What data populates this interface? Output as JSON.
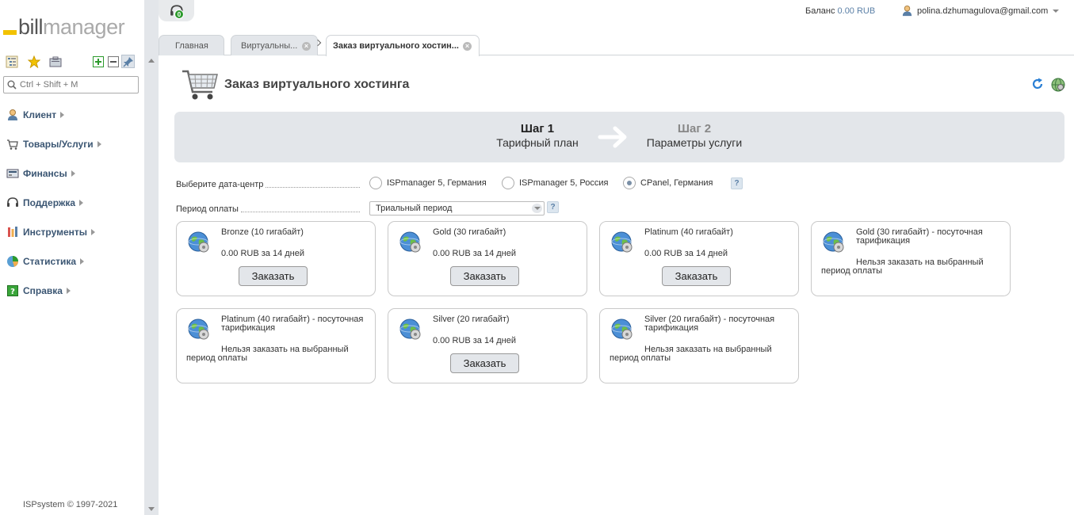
{
  "app": {
    "logo_bill": "bill",
    "logo_manager": "manager",
    "support_badge": "0",
    "copyright": "ISPsystem © 1997-2021"
  },
  "search": {
    "placeholder": "Ctrl + Shift + M"
  },
  "menu": [
    {
      "label": "Клиент",
      "icon": "client-icon"
    },
    {
      "label": "Товары/Услуги",
      "icon": "cart-icon"
    },
    {
      "label": "Финансы",
      "icon": "finance-icon"
    },
    {
      "label": "Поддержка",
      "icon": "headset-icon"
    },
    {
      "label": "Инструменты",
      "icon": "tools-icon"
    },
    {
      "label": "Статистика",
      "icon": "chart-icon"
    },
    {
      "label": "Справка",
      "icon": "help-book-icon"
    }
  ],
  "header": {
    "balance_label": "Баланс",
    "balance_value": "0.00 RUB",
    "user_email": "polina.dzhumagulova@gmail.com"
  },
  "tabs": [
    {
      "label": "Главная"
    },
    {
      "label": "Виртуальны..."
    },
    {
      "label": "Заказ виртуального хостин..."
    }
  ],
  "page": {
    "title": "Заказ виртуального хостинга"
  },
  "wizard": {
    "step1_num": "Шаг 1",
    "step1_title": "Тарифный план",
    "step2_num": "Шаг 2",
    "step2_title": "Параметры услуги"
  },
  "form": {
    "datacenter_label": "Выберите дата-центр",
    "datacenter_options": [
      {
        "label": "ISPmanager 5, Германия",
        "checked": false
      },
      {
        "label": "ISPmanager 5, Россия",
        "checked": false
      },
      {
        "label": "CPanel, Германия",
        "checked": true
      }
    ],
    "period_label": "Период оплаты",
    "period_value": "Триальный период",
    "help_glyph": "?"
  },
  "order_button_label": "Заказать",
  "plans": [
    {
      "name": "Bronze (10 гигабайт)",
      "price": "0.00 RUB за 14 дней",
      "orderable": true
    },
    {
      "name": "Gold (30 гигабайт)",
      "price": "0.00 RUB за 14 дней",
      "orderable": true
    },
    {
      "name": "Platinum (40 гигабайт)",
      "price": "0.00 RUB за 14 дней",
      "orderable": true
    },
    {
      "name": "Gold (30 гигабайт) - посуточная тарификация",
      "message": "Нельзя заказать на выбранный период оплаты",
      "orderable": false
    },
    {
      "name": "Platinum (40 гигабайт) - посуточная тарификация",
      "message": "Нельзя заказать на выбранный период оплаты",
      "orderable": false
    },
    {
      "name": "Silver (20 гигабайт)",
      "price": "0.00 RUB за 14 дней",
      "orderable": true
    },
    {
      "name": "Silver (20 гигабайт) - посуточная тарификация",
      "message": "Нельзя заказать на выбранный период оплаты",
      "orderable": false
    }
  ]
}
